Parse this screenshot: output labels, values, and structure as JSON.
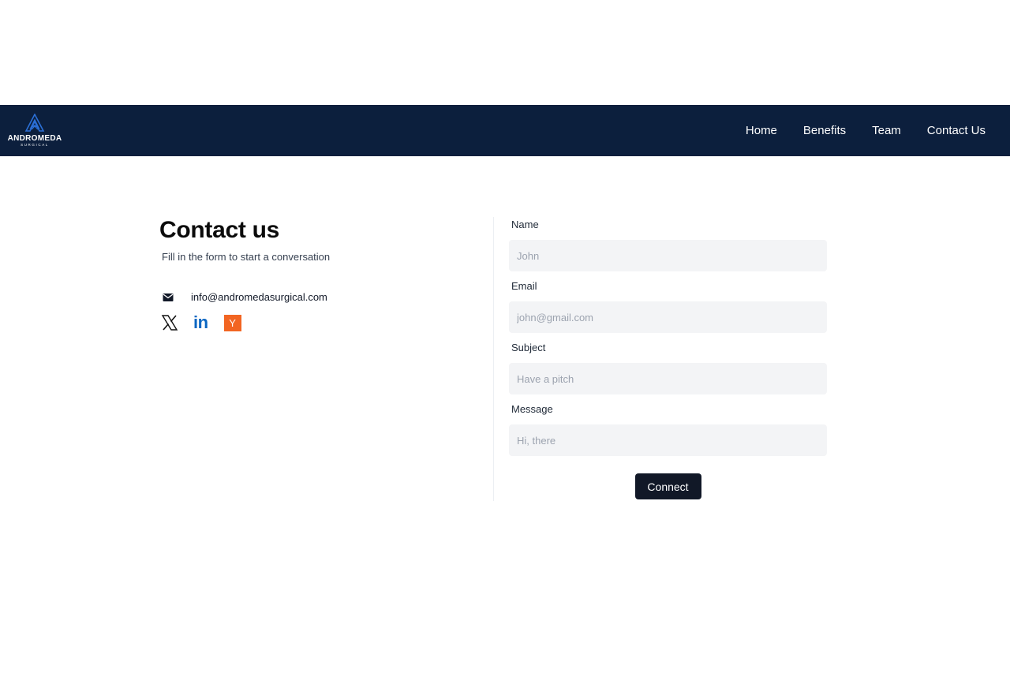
{
  "brand": {
    "name": "ANDROMEDA",
    "sub": "SURGICAL",
    "color": "#0c1f3d",
    "logo_accent": "#2b6fd6"
  },
  "nav": {
    "items": [
      {
        "label": "Home"
      },
      {
        "label": "Benefits"
      },
      {
        "label": "Team"
      },
      {
        "label": "Contact Us"
      }
    ]
  },
  "contact": {
    "title": "Contact us",
    "subtitle": "Fill in the form to start a conversation",
    "email": "info@andromedasurgical.com",
    "email_icon": "mail-icon",
    "socials": [
      {
        "name": "x-icon",
        "glyph": "𝕏"
      },
      {
        "name": "linkedin-icon",
        "glyph": "in"
      },
      {
        "name": "ycombinator-icon",
        "glyph": "Y"
      }
    ]
  },
  "form": {
    "fields": [
      {
        "label": "Name",
        "placeholder": "John",
        "value": ""
      },
      {
        "label": "Email",
        "placeholder": "john@gmail.com",
        "value": ""
      },
      {
        "label": "Subject",
        "placeholder": "Have a pitch",
        "value": ""
      },
      {
        "label": "Message",
        "placeholder": "Hi, there",
        "value": ""
      }
    ],
    "submit_label": "Connect"
  }
}
